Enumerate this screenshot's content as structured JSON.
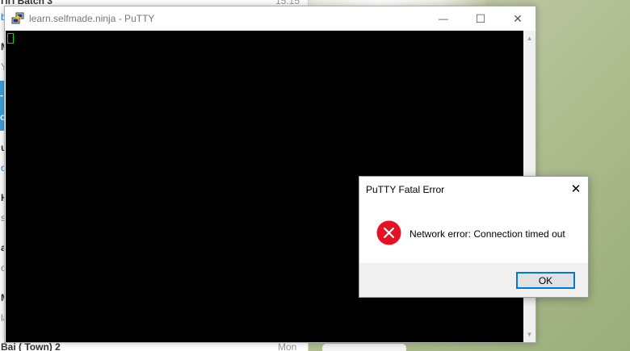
{
  "background_app": {
    "top_item_title": "ПП Batch 3",
    "top_item_time": "15:15",
    "fragments": [
      "be",
      "M",
      "Y",
      "-",
      "o",
      "u",
      "o",
      "H",
      "s",
      "a",
      "c",
      "M",
      "la"
    ],
    "bottom_item_title": "Bai ( Town) 2",
    "bottom_item_time": "Mon"
  },
  "putty": {
    "title": "learn.selfmade.ninja - PuTTY",
    "icon": "putty-icon",
    "controls": {
      "minimize": "—",
      "maximize": "☐",
      "close": "✕"
    },
    "cursor_color": "#00d800",
    "terminal_background": "#000000"
  },
  "dialog": {
    "title": "PuTTY Fatal Error",
    "close": "✕",
    "icon": "error-icon",
    "icon_color": "#e81123",
    "message": "Network error: Connection timed out",
    "ok_label": "OK",
    "focus_color": "#0078d7"
  }
}
